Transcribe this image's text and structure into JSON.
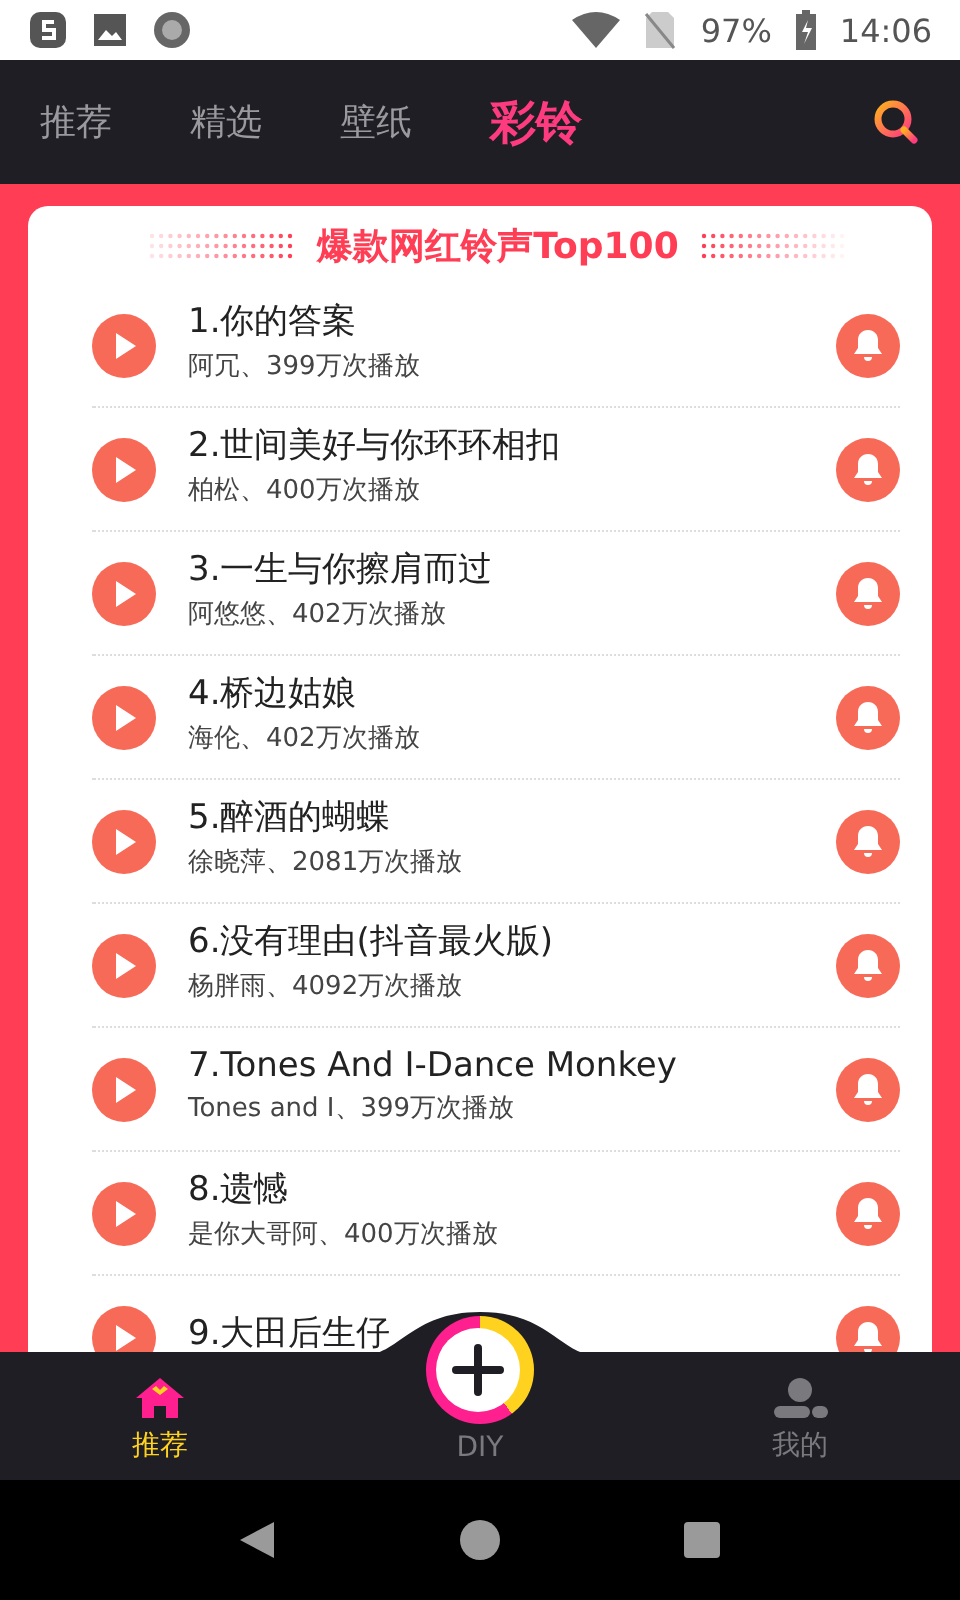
{
  "status_bar": {
    "battery": "97%",
    "time": "14:06"
  },
  "tabs": [
    {
      "label": "推荐",
      "selected": false
    },
    {
      "label": "精选",
      "selected": false
    },
    {
      "label": "壁纸",
      "selected": false
    },
    {
      "label": "彩铃",
      "selected": true
    }
  ],
  "list_title": "爆款网红铃声Top100",
  "songs": [
    {
      "title": "1.你的答案",
      "subtitle": "阿冗、399万次播放"
    },
    {
      "title": "2.世间美好与你环环相扣",
      "subtitle": "柏松、400万次播放"
    },
    {
      "title": "3.一生与你擦肩而过",
      "subtitle": "阿悠悠、402万次播放"
    },
    {
      "title": "4.桥边姑娘",
      "subtitle": "海伦、402万次播放"
    },
    {
      "title": "5.醉酒的蝴蝶",
      "subtitle": "徐晓萍、2081万次播放"
    },
    {
      "title": "6.没有理由(抖音最火版)",
      "subtitle": "杨胖雨、4092万次播放"
    },
    {
      "title": "7.Tones And I-Dance Monkey",
      "subtitle": "Tones and I、399万次播放"
    },
    {
      "title": "8.遗憾",
      "subtitle": "是你大哥阿、400万次播放"
    },
    {
      "title": "9.大田后生仔"
    }
  ],
  "bottom_nav": [
    {
      "label": "推荐",
      "kind": "home",
      "selected": true
    },
    {
      "label": "DIY",
      "kind": "diy",
      "selected": false
    },
    {
      "label": "我的",
      "kind": "profile",
      "selected": false
    }
  ]
}
